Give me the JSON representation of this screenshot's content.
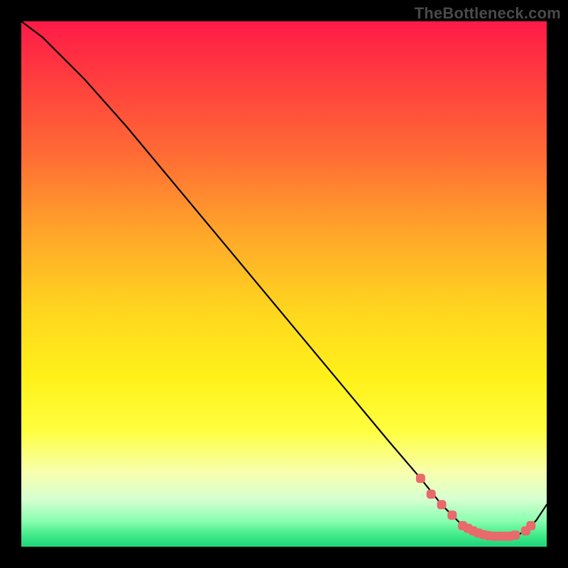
{
  "watermark": "TheBottleneck.com",
  "colors": {
    "background": "#000000",
    "gradient_top": "#ff1a48",
    "gradient_mid": "#fff11a",
    "gradient_bottom": "#1fd47a",
    "curve": "#000000",
    "marker": "#e86a6a"
  },
  "chart_data": {
    "type": "line",
    "title": "",
    "xlabel": "",
    "ylabel": "",
    "xlim": [
      0,
      100
    ],
    "ylim": [
      0,
      100
    ],
    "grid": false,
    "legend": false,
    "series": [
      {
        "name": "bottleneck-curve",
        "x": [
          0,
          4,
          8,
          12,
          20,
          30,
          40,
          50,
          60,
          70,
          76,
          80,
          82,
          84,
          86,
          88,
          90,
          92,
          94,
          96,
          98,
          100
        ],
        "y": [
          100,
          97,
          93,
          89,
          80,
          68,
          56,
          44,
          32,
          20,
          13,
          8,
          6,
          4,
          3,
          2,
          2,
          2,
          2,
          3,
          5,
          8
        ]
      }
    ],
    "markers": {
      "name": "highlighted-points",
      "x": [
        76,
        78,
        80,
        82,
        84,
        85,
        86,
        87,
        88,
        89,
        90,
        91,
        92,
        93,
        94,
        96,
        97
      ],
      "y": [
        13,
        10,
        8,
        6,
        4,
        3.5,
        3,
        2.6,
        2.3,
        2.1,
        2,
        2,
        2,
        2,
        2.2,
        3,
        4
      ]
    }
  }
}
